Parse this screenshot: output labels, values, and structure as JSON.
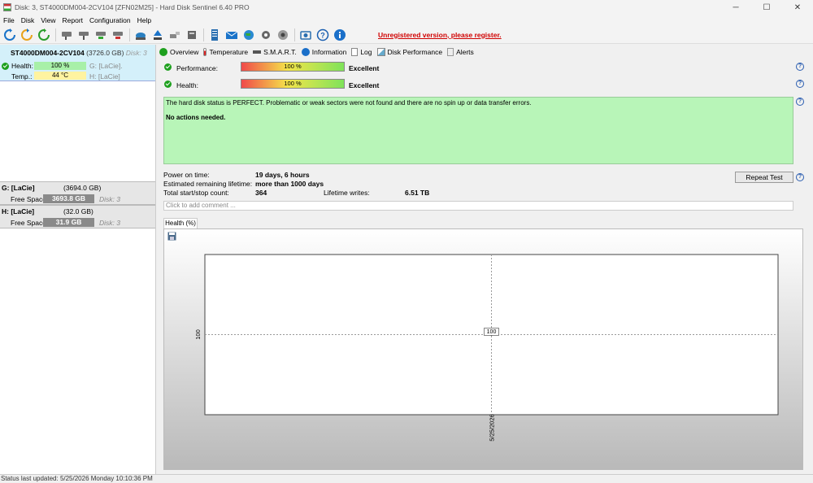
{
  "window": {
    "title": "Disk: 3, ST4000DM004-2CV104 [ZFN02M25]  -  Hard Disk Sentinel 6.40 PRO",
    "minimize": "─",
    "maximize": "☐",
    "close": "✕"
  },
  "menu": [
    "File",
    "Disk",
    "View",
    "Report",
    "Configuration",
    "Help"
  ],
  "toolbar": {
    "icons": [
      "refresh-icon",
      "refresh-all-icon",
      "disk-icon",
      "disk-settings-icon",
      "disk-test-icon",
      "disk-surface-icon",
      "disk-eject-icon",
      "report-icon",
      "send-report-icon",
      "email-icon",
      "web-icon",
      "settings-icon",
      "options-icon",
      "screenshot-icon",
      "help-icon",
      "info-icon"
    ],
    "unregistered_link": "Unregistered version, please register."
  },
  "disk": {
    "model": "ST4000DM004-2CV104",
    "capacity": "(3726.0 GB)",
    "disk_label": "Disk: 3",
    "health_label": "Health:",
    "health_value": "100 %",
    "health_fraction": 1.0,
    "temp_label": "Temp.:",
    "temp_value": "44 °C",
    "partition1": "G: [LaCie].",
    "partition2": "H: [LaCie]"
  },
  "volumes": [
    {
      "name": "G: [LaCie]",
      "size": "(3694.0 GB)",
      "free_label": "Free Space",
      "free_value": "3693.8 GB",
      "disk": "Disk: 3"
    },
    {
      "name": "H: [LaCie]",
      "size": "(32.0 GB)",
      "free_label": "Free Space",
      "free_value": "31.9 GB",
      "disk": "Disk: 3"
    }
  ],
  "tabs": [
    "Overview",
    "Temperature",
    "S.M.A.R.T.",
    "Information",
    "Log",
    "Disk Performance",
    "Alerts"
  ],
  "overview": {
    "performance_label": "Performance:",
    "performance_value": "100 %",
    "performance_rating": "Excellent",
    "health_label": "Health:",
    "health_value": "100 %",
    "health_rating": "Excellent",
    "status_text": "The hard disk status is PERFECT. Problematic or weak sectors were not found and there are no spin up or data transfer errors.",
    "actions_text": "No actions needed.",
    "power_on_label": "Power on time:",
    "power_on_value": "19 days, 6 hours",
    "remaining_label": "Estimated remaining lifetime:",
    "remaining_value": "more than 1000 days",
    "startstop_label": "Total start/stop count:",
    "startstop_value": "364",
    "writes_label": "Lifetime writes:",
    "writes_value": "6.51 TB",
    "repeat_button": "Repeat Test",
    "comment_placeholder": "Click to add comment ...",
    "help_glyph": "?"
  },
  "chart_tab": "Health (%)",
  "chart_data": {
    "type": "line",
    "x": [
      "5/25/2026"
    ],
    "series": [
      {
        "values": [
          100
        ]
      }
    ],
    "ytick": "100",
    "point_label": "100",
    "grid": true
  },
  "statusbar": "Status last updated: 5/25/2026 Monday 10:10:36 PM"
}
